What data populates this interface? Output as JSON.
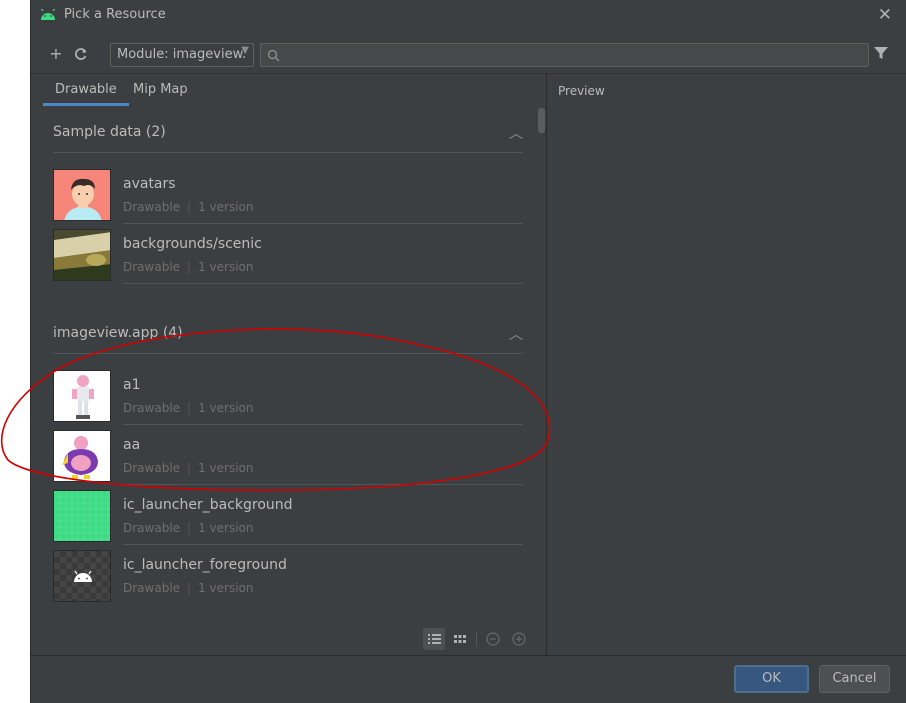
{
  "window": {
    "title": "Pick a Resource"
  },
  "toolbar": {
    "module_label": "Module: imageview.",
    "search_value": "",
    "search_placeholder": ""
  },
  "tabs": [
    {
      "label": "Drawable",
      "active": true
    },
    {
      "label": "Mip Map",
      "active": false
    }
  ],
  "preview": {
    "label": "Preview"
  },
  "sections": [
    {
      "title": "Sample data (2)",
      "items": [
        {
          "name": "avatars",
          "type": "Drawable",
          "versions": "1 version"
        },
        {
          "name": "backgrounds/scenic",
          "type": "Drawable",
          "versions": "1 version"
        }
      ]
    },
    {
      "title": "imageview.app (4)",
      "items": [
        {
          "name": "a1",
          "type": "Drawable",
          "versions": "1 version"
        },
        {
          "name": "aa",
          "type": "Drawable",
          "versions": "1 version"
        },
        {
          "name": "ic_launcher_background",
          "type": "Drawable",
          "versions": "1 version"
        },
        {
          "name": "ic_launcher_foreground",
          "type": "Drawable",
          "versions": "1 version"
        }
      ]
    }
  ],
  "buttons": {
    "ok": "OK",
    "cancel": "Cancel"
  },
  "icons": {
    "add": "plus-icon",
    "refresh": "refresh-icon",
    "search": "search-icon",
    "filter": "filter-icon",
    "close": "close-icon"
  },
  "colors": {
    "accent": "#4a88c7",
    "background": "#3c3f41",
    "annotation": "#d40000"
  }
}
